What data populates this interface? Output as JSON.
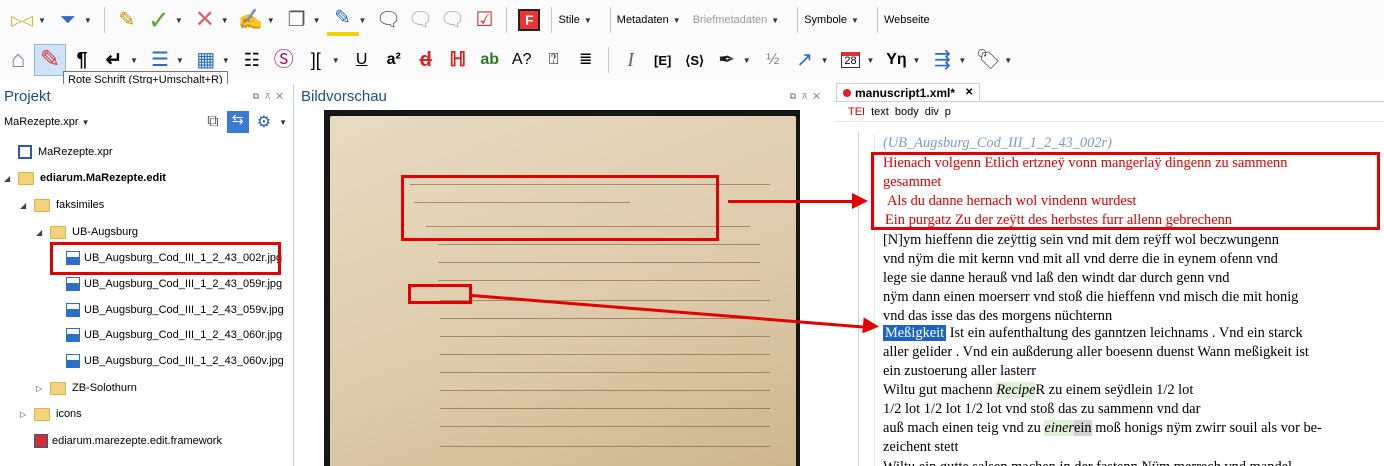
{
  "toolbar1": {
    "menus": [
      {
        "label": "Stile",
        "disabled": false
      },
      {
        "label": "Metadaten",
        "disabled": false
      },
      {
        "label": "Briefmetadaten",
        "disabled": true
      },
      {
        "label": "Symbole",
        "disabled": false
      },
      {
        "label": "Webseite",
        "disabled": false
      }
    ]
  },
  "toolbar2": {
    "pilcrow": "¶",
    "enter": "↵",
    "u": "U",
    "a2": "a²",
    "d": "d",
    "ab": "ab",
    "italic": "I",
    "e_brackets": "[E]",
    "s_brackets": "⟨S⟩",
    "page28": "28",
    "yn": "Yη"
  },
  "tooltip": "Rote Schrift (Strg+Umschalt+R)",
  "project": {
    "title": "Projekt",
    "selector": "MaRezepte.xpr",
    "tree": [
      {
        "label": "MaRezepte.xpr",
        "level": 0,
        "type": "project",
        "arrow": ""
      },
      {
        "label": "ediarum.MaRezepte.edit",
        "level": 0,
        "type": "folder",
        "arrow": "◢",
        "bold": true
      },
      {
        "label": "faksimiles",
        "level": 1,
        "type": "folder",
        "arrow": "◢"
      },
      {
        "label": "UB-Augsburg",
        "level": 2,
        "type": "folder",
        "arrow": "◢"
      },
      {
        "label": "UB_Augsburg_Cod_III_1_2_43_002r.jpg",
        "level": 3,
        "type": "image",
        "arrow": ""
      },
      {
        "label": "UB_Augsburg_Cod_III_1_2_43_059r.jpg",
        "level": 3,
        "type": "image",
        "arrow": ""
      },
      {
        "label": "UB_Augsburg_Cod_III_1_2_43_059v.jpg",
        "level": 3,
        "type": "image",
        "arrow": ""
      },
      {
        "label": "UB_Augsburg_Cod_III_1_2_43_060r.jpg",
        "level": 3,
        "type": "image",
        "arrow": ""
      },
      {
        "label": "UB_Augsburg_Cod_III_1_2_43_060v.jpg",
        "level": 3,
        "type": "image",
        "arrow": ""
      },
      {
        "label": "ZB-Solothurn",
        "level": 2,
        "type": "folder",
        "arrow": "▷"
      },
      {
        "label": "icons",
        "level": 1,
        "type": "folder",
        "arrow": "▷"
      },
      {
        "label": "ediarum.marezepte.edit.framework",
        "level": 1,
        "type": "framework",
        "arrow": ""
      }
    ]
  },
  "preview": {
    "title": "Bildvorschau"
  },
  "editor": {
    "tab_label": "manuscript1.xml*",
    "close": "✕",
    "breadcrumbs": [
      "TEI",
      "text",
      "body",
      "div",
      "p"
    ],
    "lines": [
      {
        "text": "(UB_Augsburg_Cod_III_1_2_43_002r)",
        "style": "meta"
      },
      {
        "text": "Hienach volgenn Etlich ertzneÿ vonn mangerlaÿ dingenn zu sammenn",
        "style": "red"
      },
      {
        "text": "gesammet",
        "style": "red"
      },
      {
        "text": "Als du danne hernach wol vindenn wurdest",
        "style": "red"
      },
      {
        "text": "Ein purgatz Zu der zeÿtt des herbstes furr allenn gebrechenn",
        "style": "red"
      },
      {
        "text": "[N]ym hieffenn die zeÿttig sein vnd mit dem reÿff wol beczwungenn",
        "style": "normal"
      },
      {
        "text": "vnd nÿm die mit kernn vnd mit all vnd derre die in eynem ofenn vnd",
        "style": "normal"
      },
      {
        "text": "lege sie danne herauß vnd laß den windt dar durch genn vnd",
        "style": "normal"
      },
      {
        "text": "nÿm dann einen moerserr vnd stoß die hieffenn vnd misch die mit honig",
        "style": "normal"
      },
      {
        "text": "vnd das isse das des morgens nüchternn",
        "style": "normal"
      }
    ],
    "line_highlight": "Meßigkeit",
    "line_after_highlight": " Ist ein aufenthaltung des ganntzen leichnams . Vnd ein starck",
    "lines2": [
      "aller gelider . Vnd ein außderung aller boesenn duenst Wann meßigkeit ist",
      "ein zustoerung aller lasterr"
    ],
    "recipe_pre": "Wiltu gut machenn ",
    "recipe_word": "Recipe",
    "recipe_post": "R zu einem seÿdlein 1/2 lot",
    "line_lot": "1/2 lot 1/2 lot 1/2 lot vnd stoß das zu sammenn vnd dar",
    "einer_pre": "auß mach einen teig vnd zu ",
    "einer_word": "einer",
    "einer_box": "ein",
    "einer_post": " moß honigs nÿm zwirr souil als vor be-",
    "line_zeichent": "zeichent stett",
    "line_last": "Wiltu ein gutte salsen machen in der fastenn Nÿm merrech vnd mandel"
  }
}
